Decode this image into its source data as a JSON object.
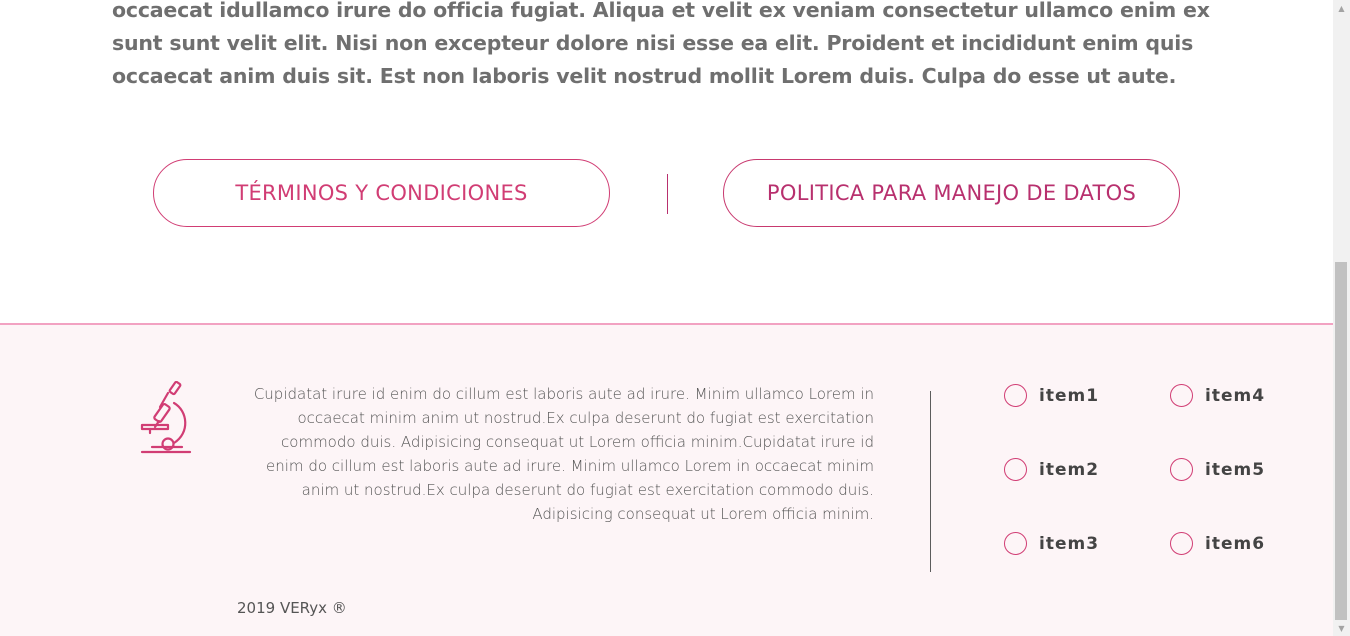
{
  "intro": {
    "text": "occaecat idullamco irure do officia fugiat. Aliqua et velit ex veniam consectetur ullamco enim ex sunt sunt velit elit. Nisi non excepteur dolore nisi esse ea elit. Proident et incididunt enim quis occaecat anim duis sit. Est non laboris velit nostrud mollit Lorem duis. Culpa do esse ut aute."
  },
  "legal": {
    "terms_label": "TÉRMINOS Y CONDICIONES",
    "privacy_label": "POLITICA PARA MANEJO DE DATOS"
  },
  "footer": {
    "icon": "microscope-icon",
    "description": "Cupidatat irure id enim do cillum est laboris aute ad irure. Minim ullamco Lorem in occaecat minim anim ut nostrud.Ex culpa deserunt do fugiat est exercitation commodo duis. Adipisicing consequat ut Lorem officia minim.Cupidatat irure id enim do cillum est laboris aute ad irure. Minim ullamco Lorem in occaecat minim anim ut nostrud.Ex culpa deserunt do fugiat est exercitation commodo duis. Adipisicing consequat ut Lorem officia minim.",
    "options": [
      "item1",
      "item2",
      "item3",
      "item4",
      "item5",
      "item6"
    ],
    "copyright": "2019 VERyx ®"
  },
  "colors": {
    "accent": "#d13d74",
    "accent_dark": "#b8306e",
    "footer_bg": "#fdf5f7",
    "footer_border": "#f2a2c2",
    "text_gray": "#6f6f6f"
  }
}
